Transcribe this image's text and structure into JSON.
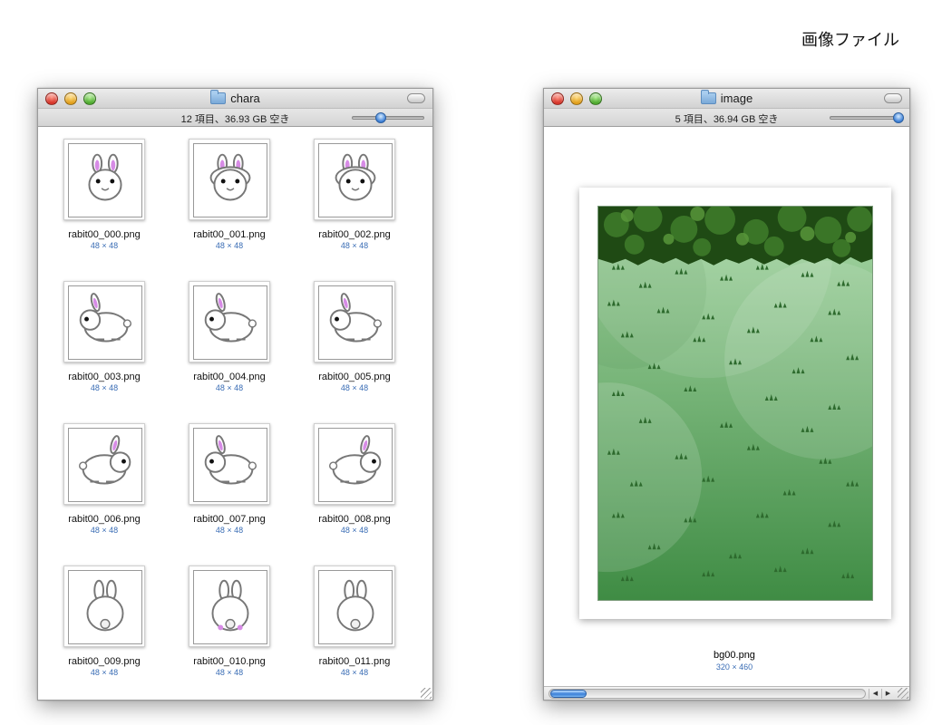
{
  "page": {
    "heading": "画像ファイル"
  },
  "chara_window": {
    "title": "chara",
    "status": "12 項目、36.93 GB 空き",
    "icon_size_slider": 0.4,
    "files": [
      {
        "name": "rabit00_000.png",
        "size": "48 × 48"
      },
      {
        "name": "rabit00_001.png",
        "size": "48 × 48"
      },
      {
        "name": "rabit00_002.png",
        "size": "48 × 48"
      },
      {
        "name": "rabit00_003.png",
        "size": "48 × 48"
      },
      {
        "name": "rabit00_004.png",
        "size": "48 × 48"
      },
      {
        "name": "rabit00_005.png",
        "size": "48 × 48"
      },
      {
        "name": "rabit00_006.png",
        "size": "48 × 48"
      },
      {
        "name": "rabit00_007.png",
        "size": "48 × 48"
      },
      {
        "name": "rabit00_008.png",
        "size": "48 × 48"
      },
      {
        "name": "rabit00_009.png",
        "size": "48 × 48"
      },
      {
        "name": "rabit00_010.png",
        "size": "48 × 48"
      },
      {
        "name": "rabit00_011.png",
        "size": "48 × 48"
      }
    ]
  },
  "image_window": {
    "title": "image",
    "status": "5 項目、36.94 GB 空き",
    "icon_size_slider": 0.95,
    "file": {
      "name": "bg00.png",
      "size": "320 × 460"
    },
    "scroll_position": 0
  },
  "colors": {
    "accent": "#3a6db5",
    "grass_light": "#a6d6a4",
    "grass_dark": "#3f8c44",
    "foliage": "#1f4a14",
    "rabbit_ear": "#d78be6"
  },
  "icons": {
    "window_controls": [
      "close-icon",
      "minimize-icon",
      "zoom-icon"
    ],
    "folder": "folder-icon",
    "toolbar_toggle": "toolbar-toggle-icon"
  }
}
